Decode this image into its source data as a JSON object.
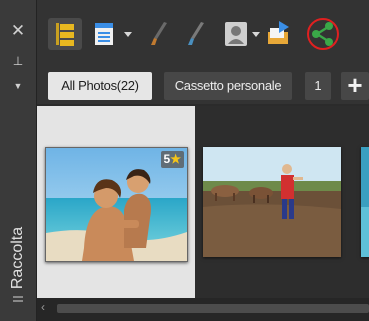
{
  "sidebar": {
    "label": "Raccolta",
    "icons": [
      "close-icon",
      "pin-icon",
      "chevron-down-icon"
    ]
  },
  "toolbar": {
    "icons": [
      "folder-tree-icon",
      "list-view-icon",
      "brush-icon",
      "brush-gray-icon",
      "user-icon",
      "export-icon",
      "share-icon"
    ]
  },
  "tabs": {
    "all": "All Photos(22)",
    "personal": "Cassetto personale",
    "number": "1",
    "add": "+"
  },
  "thumbs": [
    {
      "rating": "5",
      "selected": true
    },
    {
      "selected": false
    },
    {
      "selected": false
    }
  ],
  "colors": {
    "share_highlight": "#e02020",
    "star": "#f5c518",
    "selected_background": "#e4e4e4"
  }
}
